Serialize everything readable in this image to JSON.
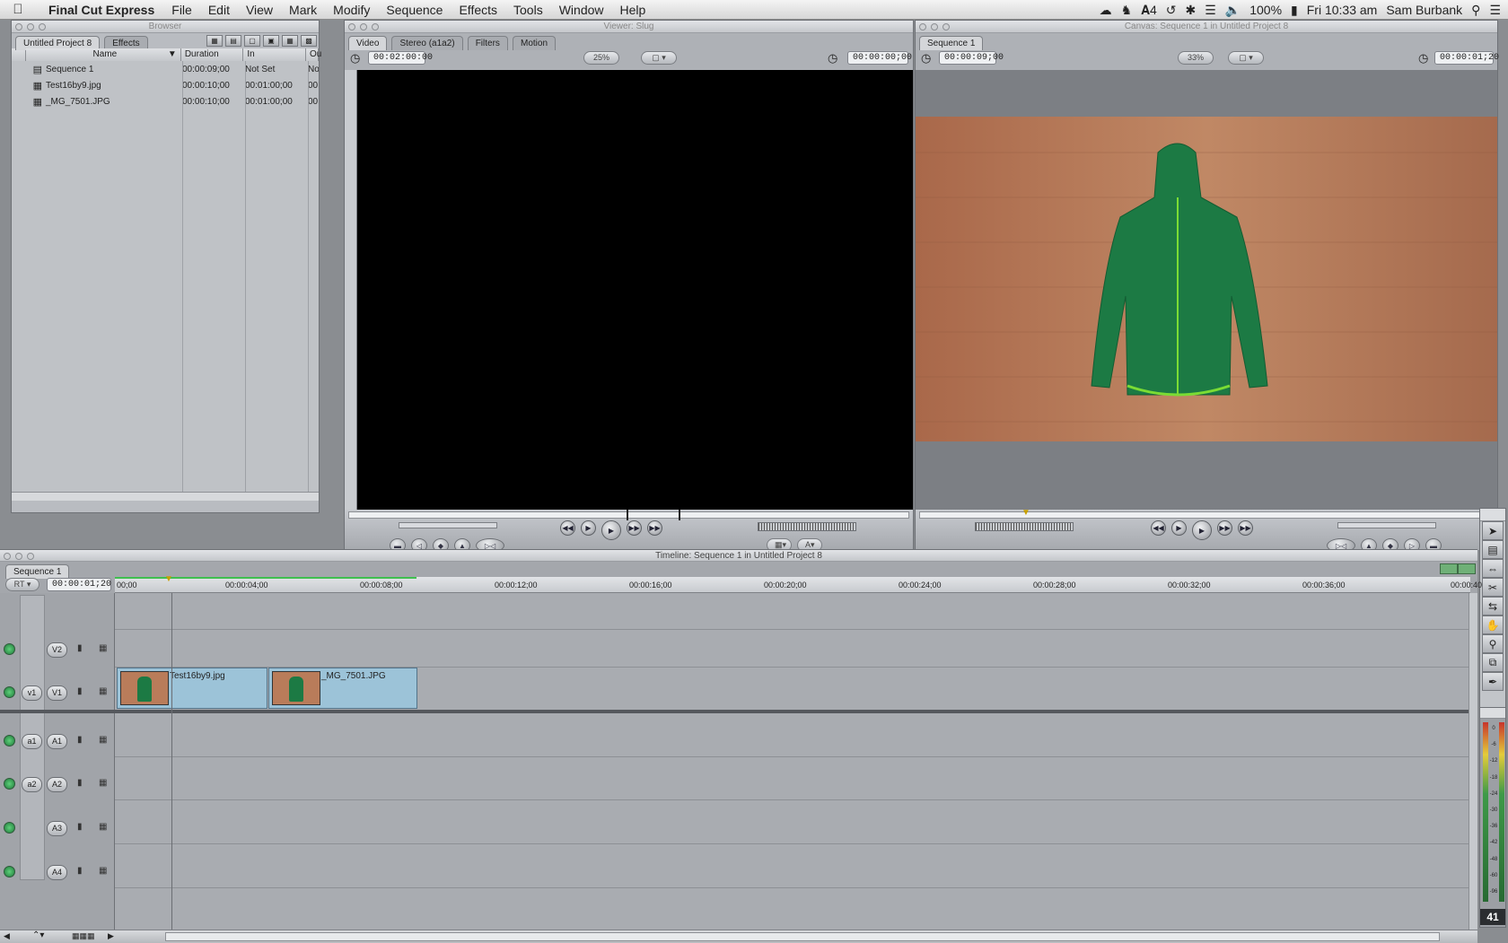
{
  "menubar": {
    "app_name": "Final Cut Express",
    "items": [
      "File",
      "Edit",
      "View",
      "Mark",
      "Modify",
      "Sequence",
      "Effects",
      "Tools",
      "Window",
      "Help"
    ],
    "status": {
      "adobe_count": "4",
      "battery": "100%",
      "clock": "Fri 10:33 am",
      "user": "Sam Burbank"
    }
  },
  "browser": {
    "title": "Browser",
    "tabs": [
      "Untitled Project 8",
      "Effects"
    ],
    "columns": [
      "Name",
      "Duration",
      "In",
      "Ou"
    ],
    "rows": [
      {
        "name": "Sequence 1",
        "duration": "00:00:09;00",
        "in": "Not Set",
        "out": "No"
      },
      {
        "name": "Test16by9.jpg",
        "duration": "00:00:10;00",
        "in": "00:01:00;00",
        "out": "00"
      },
      {
        "name": "_MG_7501.JPG",
        "duration": "00:00:10;00",
        "in": "00:01:00;00",
        "out": "00"
      }
    ]
  },
  "viewer": {
    "title": "Viewer: Slug",
    "tabs": [
      "Video",
      "Stereo (a1a2)",
      "Filters",
      "Motion"
    ],
    "duration_tc": "00:02:00:00",
    "zoom": "25%",
    "current_tc": "00:00:00;00"
  },
  "canvas": {
    "title": "Canvas: Sequence 1 in Untitled Project 8",
    "tab": "Sequence 1",
    "duration_tc": "00:00:09;00",
    "zoom": "33%",
    "current_tc": "00:00:01;20"
  },
  "timeline": {
    "title": "Timeline: Sequence 1 in Untitled Project 8",
    "tab": "Sequence 1",
    "rt_label": "RT",
    "current_tc": "00:00:01;20",
    "ruler": [
      "00;00",
      "00:00:04;00",
      "00:00:08;00",
      "00:00:12;00",
      "00:00:16;00",
      "00:00:20;00",
      "00:00:24;00",
      "00:00:28;00",
      "00:00:32;00",
      "00:00:36;00",
      "00:00:40"
    ],
    "video_tracks": [
      {
        "src": "",
        "dest": "V2"
      },
      {
        "src": "v1",
        "dest": "V1"
      }
    ],
    "audio_tracks": [
      {
        "src": "a1",
        "dest": "A1"
      },
      {
        "src": "a2",
        "dest": "A2"
      },
      {
        "src": "",
        "dest": "A3"
      },
      {
        "src": "",
        "dest": "A4"
      }
    ],
    "clips": [
      {
        "name": "Test16by9.jpg"
      },
      {
        "name": "_MG_7501.JPG"
      }
    ]
  },
  "audio_meter": {
    "scale": [
      "0",
      "-6",
      "-12",
      "-18",
      "-24",
      "-30",
      "-36",
      "-42",
      "-48",
      "-60",
      "-96"
    ],
    "level_label": "41"
  },
  "colors": {
    "panel_bg": "#b9bcc1",
    "clip_fill": "#9cc3d8",
    "floor_wood": "#b97c5a",
    "jacket": "#1c7a44",
    "jacket_zipper": "#7bdc34"
  }
}
